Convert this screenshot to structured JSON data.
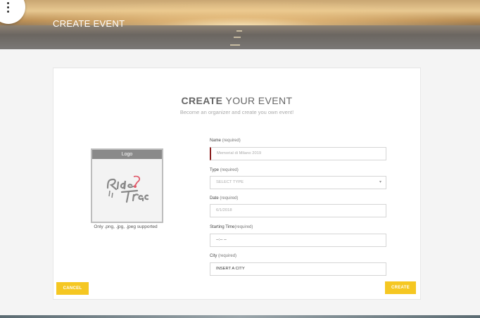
{
  "hero": {
    "title": "CREATE EVENT"
  },
  "heading": {
    "strong": "CREATE",
    "rest": "YOUR EVENT",
    "subtitle": "Become an organizer and create you own event!"
  },
  "logo": {
    "header": "Logo",
    "note": "Only .png, .jpg, .jpeg supported"
  },
  "form": {
    "name": {
      "label": "Name",
      "req": "(required)",
      "placeholder": "Memorial di Milano 2019"
    },
    "type": {
      "label": "Type",
      "req": "(required)",
      "value": "SELECT TYPE"
    },
    "date": {
      "label": "Date",
      "req": "(required)",
      "value": "6/1/2018"
    },
    "start": {
      "label": "Starting Time",
      "req": "(required)",
      "value": "--:-- --"
    },
    "city": {
      "label": "City",
      "req": "(required)",
      "value": "INSERT A CITY"
    }
  },
  "buttons": {
    "cancel": "CANCEL",
    "create": "CREATE"
  },
  "colors": {
    "accent": "#f5c722",
    "field_marker": "#8b1e1e"
  }
}
